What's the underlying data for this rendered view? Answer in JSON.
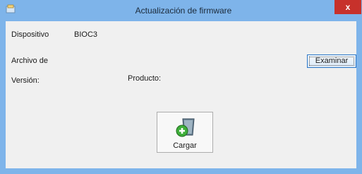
{
  "window": {
    "title": "Actualización de firmware",
    "close_label": "x"
  },
  "form": {
    "device_label": "Dispositivo",
    "device_value": "BIOC3",
    "file_label": "Archivo de",
    "browse_label": "Examinar",
    "version_label": "Versión:",
    "product_label": "Producto:",
    "load_label": "Cargar"
  },
  "icons": {
    "app": "app-icon",
    "close": "close-icon",
    "load": "upload-bin-icon"
  }
}
